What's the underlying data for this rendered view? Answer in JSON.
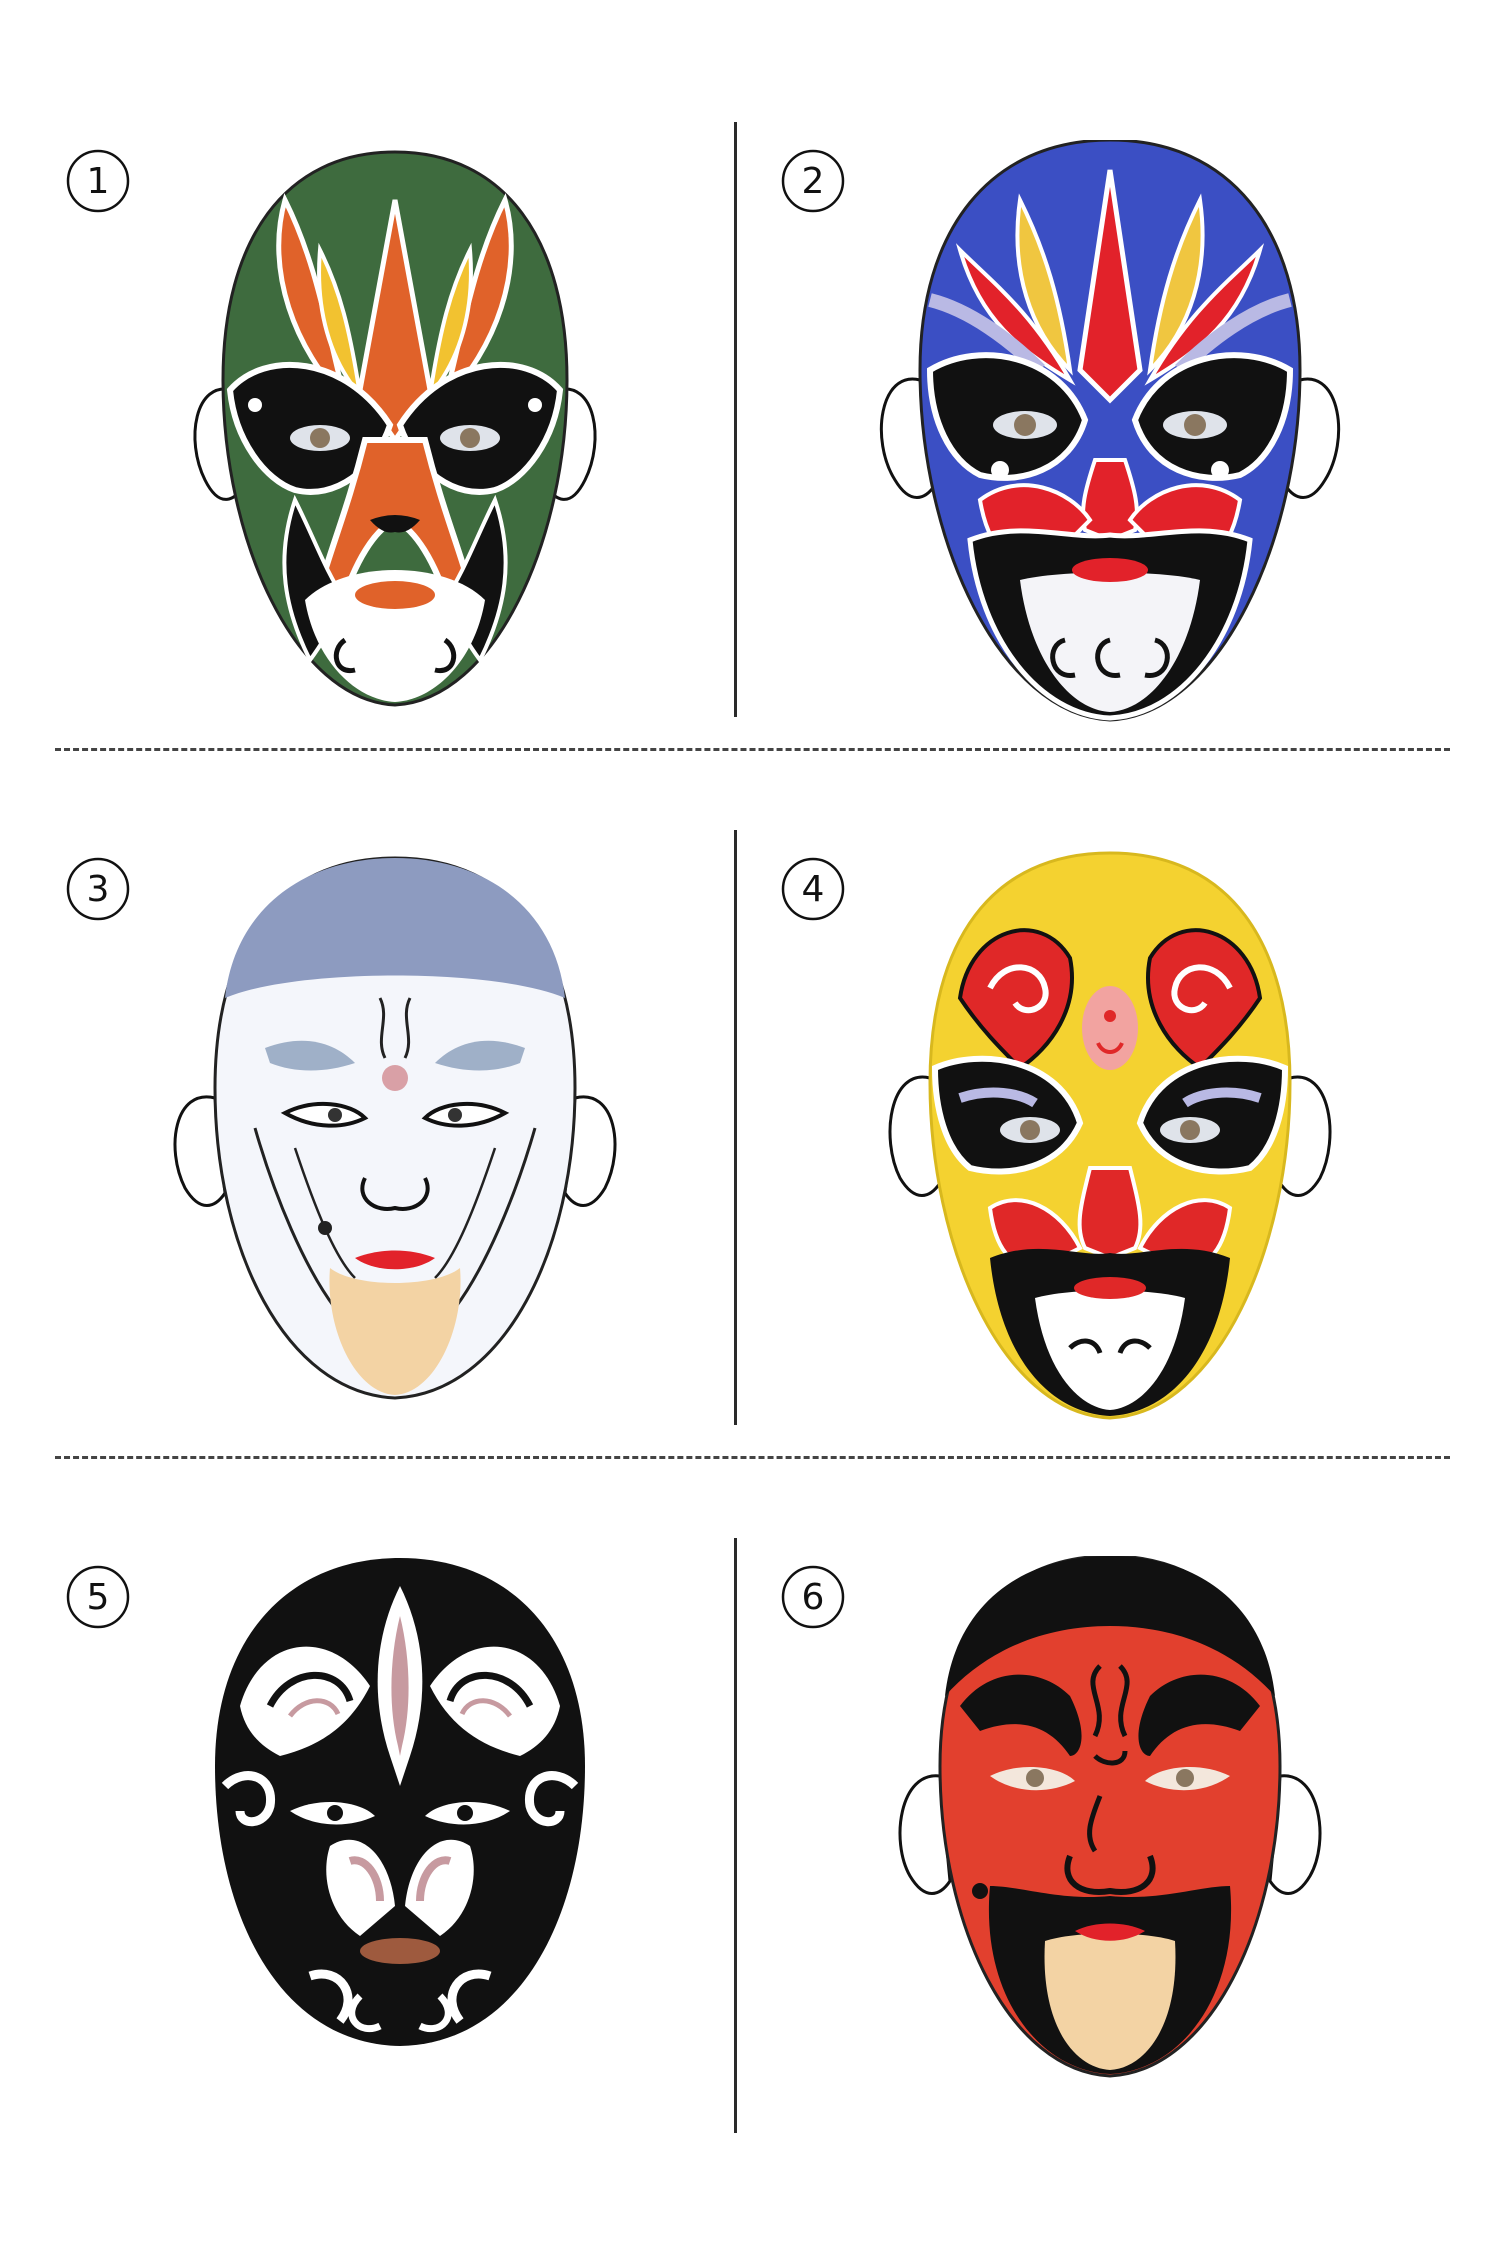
{
  "items": [
    {
      "label": "1",
      "bg": "#3e6b3e",
      "accent": "#e0622a",
      "accent2": "#f2c230",
      "mark": "#111111"
    },
    {
      "label": "2",
      "bg": "#3b4fc4",
      "accent": "#e2222a",
      "accent2": "#f0c640",
      "mark": "#111111"
    },
    {
      "label": "3",
      "bg": "#f4f6fb",
      "accent": "#8d9bc0",
      "accent2": "#f3d3a4",
      "mark": "#222222"
    },
    {
      "label": "4",
      "bg": "#f4d230",
      "accent": "#e02828",
      "accent2": "#b9b9e4",
      "mark": "#111111"
    },
    {
      "label": "5",
      "bg": "#111111",
      "accent": "#ffffff",
      "accent2": "#c79aa0",
      "mark": "#111111"
    },
    {
      "label": "6",
      "bg": "#e2402e",
      "accent": "#111111",
      "accent2": "#f3d3a4",
      "mark": "#111111"
    }
  ]
}
